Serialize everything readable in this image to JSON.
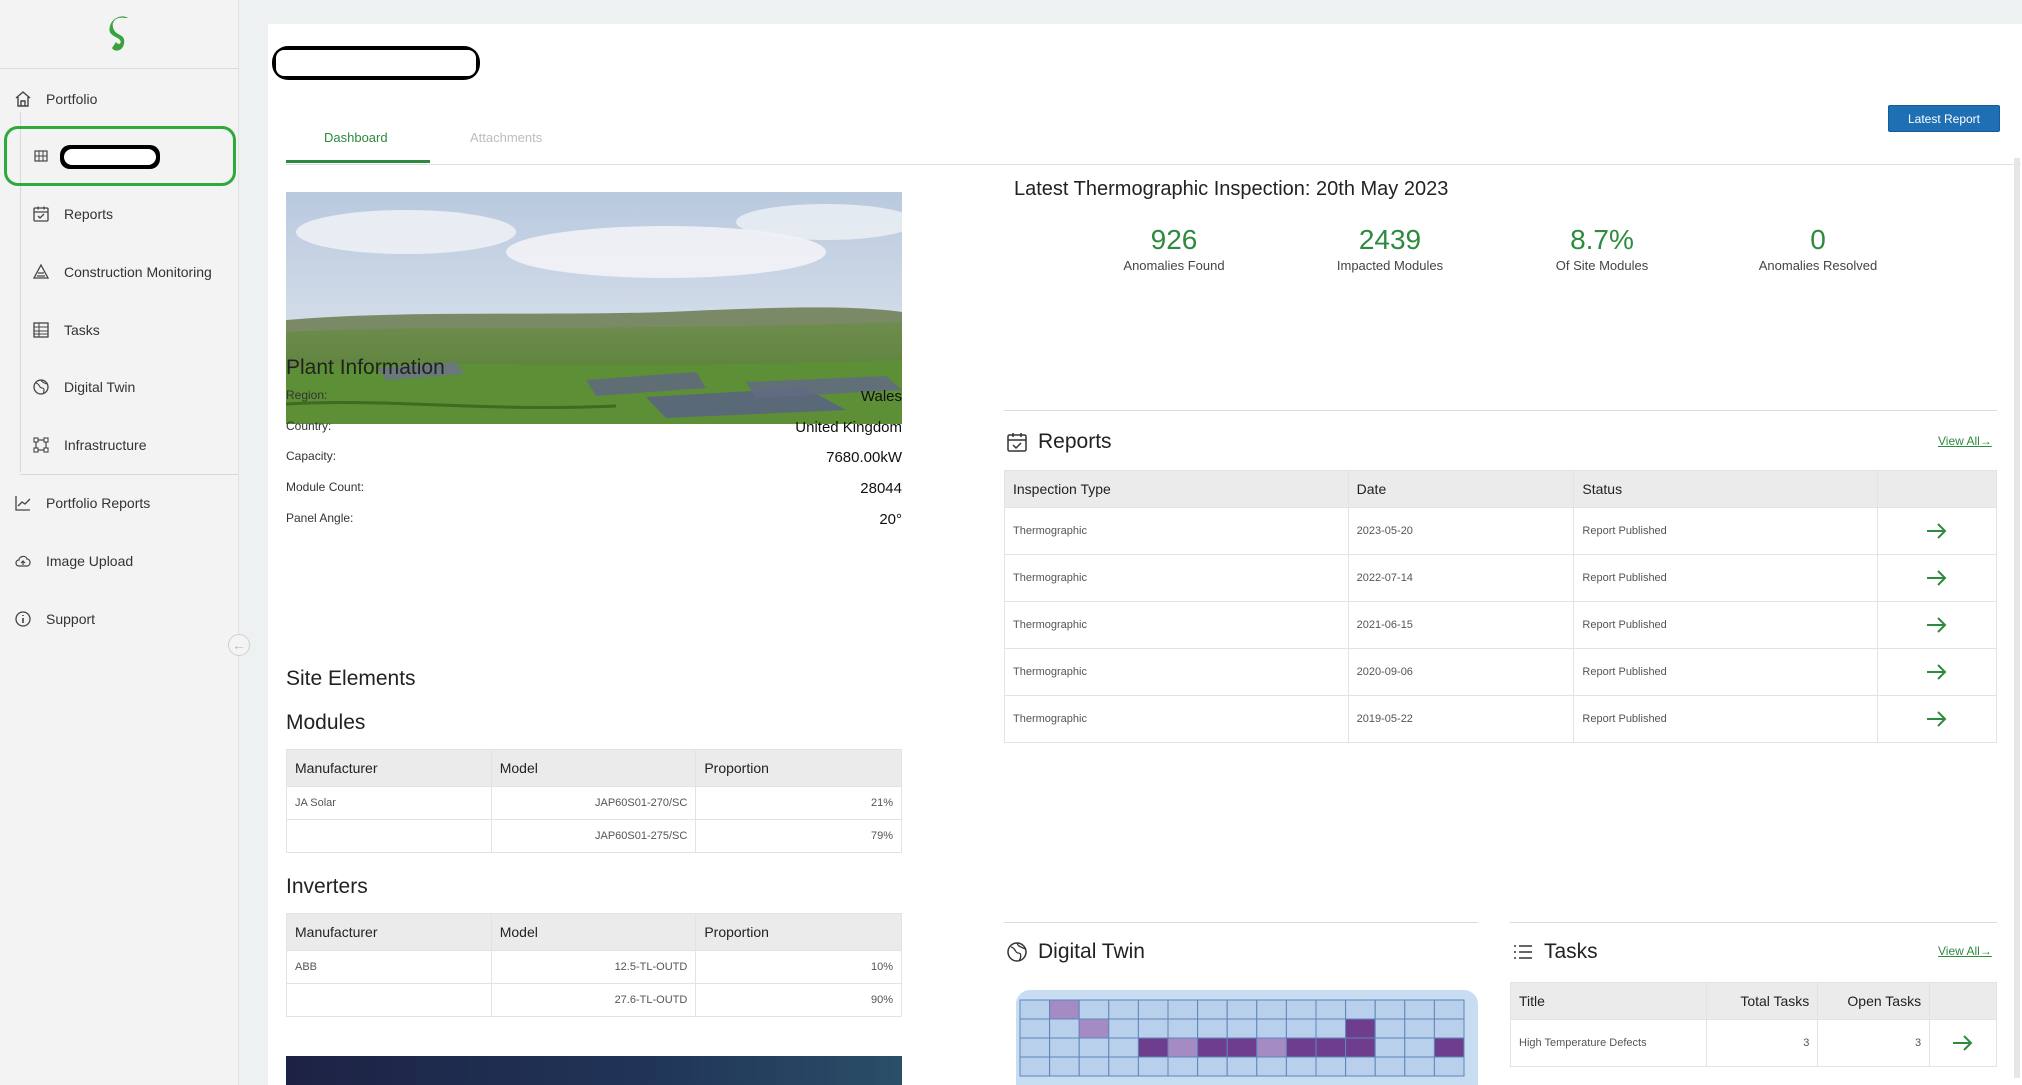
{
  "sidebar": {
    "items": [
      {
        "label": "Portfolio",
        "icon": "home-icon"
      },
      {
        "label": "",
        "icon": "grid-icon"
      },
      {
        "label": "Reports",
        "icon": "calendar-check-icon"
      },
      {
        "label": "Construction Monitoring",
        "icon": "construction-icon"
      },
      {
        "label": "Tasks",
        "icon": "table-icon"
      },
      {
        "label": "Digital Twin",
        "icon": "globe-icon"
      },
      {
        "label": "Infrastructure",
        "icon": "frame-icon"
      },
      {
        "label": "Portfolio Reports",
        "icon": "chart-line-icon"
      },
      {
        "label": "Image Upload",
        "icon": "cloud-upload-icon"
      },
      {
        "label": "Support",
        "icon": "info-icon"
      }
    ]
  },
  "tabs": [
    {
      "label": "Dashboard",
      "active": true
    },
    {
      "label": "Attachments",
      "active": false
    }
  ],
  "latest_report_button": "Latest Report",
  "inspection": {
    "title": "Latest Thermographic Inspection: 20th May 2023",
    "kpis": [
      {
        "value": "926",
        "label": "Anomalies Found"
      },
      {
        "value": "2439",
        "label": "Impacted Modules"
      },
      {
        "value": "8.7%",
        "label": "Of Site Modules"
      },
      {
        "value": "0",
        "label": "Anomalies Resolved"
      }
    ]
  },
  "plant": {
    "title": "Plant Information",
    "rows": [
      {
        "label": "Region:",
        "value": "Wales"
      },
      {
        "label": "Country:",
        "value": "United Kingdom"
      },
      {
        "label": "Capacity:",
        "value": "7680.00kW"
      },
      {
        "label": "Module Count:",
        "value": "28044"
      },
      {
        "label": "Panel Angle:",
        "value": "20°"
      }
    ]
  },
  "site_elements": {
    "title": "Site Elements",
    "modules": {
      "title": "Modules",
      "headers": [
        "Manufacturer",
        "Model",
        "Proportion"
      ],
      "rows": [
        [
          "JA Solar",
          "JAP60S01-270/SC",
          "21%"
        ],
        [
          "",
          "JAP60S01-275/SC",
          "79%"
        ]
      ]
    },
    "inverters": {
      "title": "Inverters",
      "headers": [
        "Manufacturer",
        "Model",
        "Proportion"
      ],
      "rows": [
        [
          "ABB",
          "12.5-TL-OUTD",
          "10%"
        ],
        [
          "",
          "27.6-TL-OUTD",
          "90%"
        ]
      ]
    }
  },
  "reports": {
    "title": "Reports",
    "view_all": "View All",
    "headers": [
      "Inspection Type",
      "Date",
      "Status",
      ""
    ],
    "rows": [
      [
        "Thermographic",
        "2023-05-20",
        "Report Published"
      ],
      [
        "Thermographic",
        "2022-07-14",
        "Report Published"
      ],
      [
        "Thermographic",
        "2021-06-15",
        "Report Published"
      ],
      [
        "Thermographic",
        "2020-09-06",
        "Report Published"
      ],
      [
        "Thermographic",
        "2019-05-22",
        "Report Published"
      ]
    ]
  },
  "digital_twin": {
    "title": "Digital Twin"
  },
  "tasks": {
    "title": "Tasks",
    "view_all": "View All",
    "headers": [
      "Title",
      "Total Tasks",
      "Open Tasks",
      ""
    ],
    "rows": [
      [
        "High Temperature Defects",
        "3",
        "3"
      ]
    ]
  },
  "colors": {
    "accent_green": "#2d8a3e",
    "button_blue": "#1f6fb5",
    "highlight_ring": "#2faa3a",
    "twin_cell": "#b9d0ec",
    "twin_defect_dark": "#6f3d8e",
    "twin_defect_light": "#a58bc4"
  }
}
